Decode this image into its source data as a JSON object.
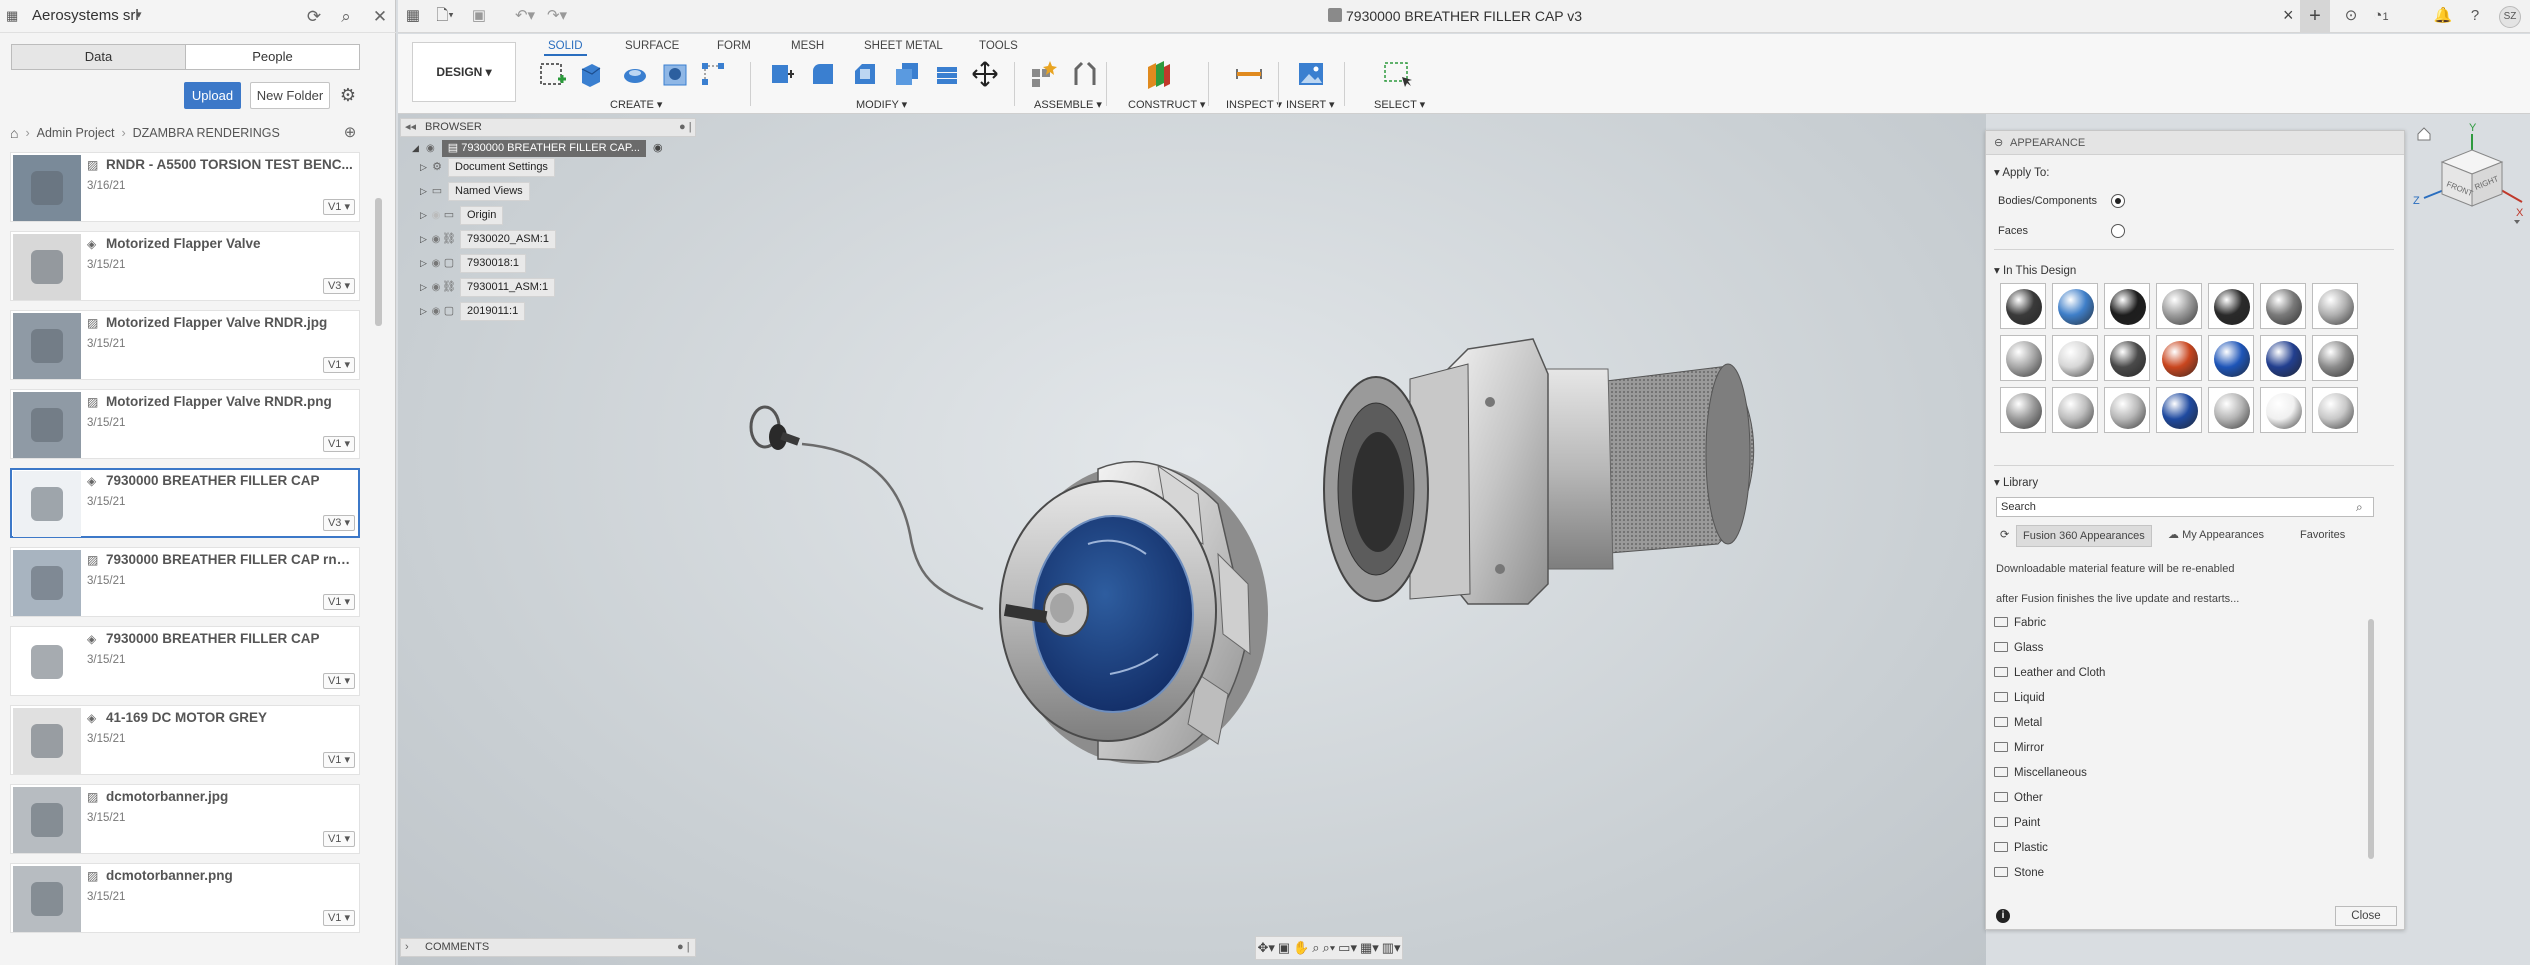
{
  "left_panel": {
    "hub_name": "Aerosystems srl",
    "tabs": [
      {
        "label": "Data",
        "active": true
      },
      {
        "label": "People",
        "active": false
      }
    ],
    "upload_label": "Upload",
    "new_folder_label": "New Folder",
    "breadcrumb": [
      "Admin Project",
      "DZAMBRA RENDERINGS"
    ],
    "items": [
      {
        "name": "RNDR - A5500 TORSION TEST BENC...",
        "date": "3/16/21",
        "version": "V1",
        "type": "image"
      },
      {
        "name": "Motorized Flapper Valve",
        "date": "3/15/21",
        "version": "V3",
        "type": "design"
      },
      {
        "name": "Motorized Flapper Valve RNDR.jpg",
        "date": "3/15/21",
        "version": "V1",
        "type": "image"
      },
      {
        "name": "Motorized Flapper Valve RNDR.png",
        "date": "3/15/21",
        "version": "V1",
        "type": "image"
      },
      {
        "name": "7930000 BREATHER FILLER CAP",
        "date": "3/15/21",
        "version": "V3",
        "type": "design",
        "selected": true
      },
      {
        "name": "7930000 BREATHER FILLER CAP rndr...",
        "date": "3/15/21",
        "version": "V1",
        "type": "image"
      },
      {
        "name": "7930000 BREATHER FILLER CAP",
        "date": "3/15/21",
        "version": "V1",
        "type": "design"
      },
      {
        "name": "41-169 DC MOTOR GREY",
        "date": "3/15/21",
        "version": "V1",
        "type": "design"
      },
      {
        "name": "dcmotorbanner.jpg",
        "date": "3/15/21",
        "version": "V1",
        "type": "image"
      },
      {
        "name": "dcmotorbanner.png",
        "date": "3/15/21",
        "version": "V1",
        "type": "image"
      }
    ]
  },
  "topbar": {
    "document_title": "7930000 BREATHER FILLER CAP v3",
    "job_count": "1",
    "user_initials": "SZ"
  },
  "toolbar": {
    "workspace": "DESIGN",
    "tabs": [
      "SOLID",
      "SURFACE",
      "FORM",
      "MESH",
      "SHEET METAL",
      "TOOLS"
    ],
    "active_tab": "SOLID",
    "groups": [
      "CREATE",
      "MODIFY",
      "ASSEMBLE",
      "CONSTRUCT",
      "INSPECT",
      "INSERT",
      "SELECT"
    ]
  },
  "browser": {
    "title": "BROWSER",
    "root": "7930000 BREATHER FILLER CAP...",
    "nodes": [
      "Document Settings",
      "Named Views",
      "Origin",
      "7930020_ASM:1",
      "7930018:1",
      "7930011_ASM:1",
      "2019011:1"
    ]
  },
  "comments_label": "COMMENTS",
  "appearance": {
    "title": "APPEARANCE",
    "apply_to_label": "Apply To:",
    "opt_bodies": "Bodies/Components",
    "opt_faces": "Faces",
    "selected_option": "Bodies/Components",
    "in_design_label": "In This Design",
    "library_label": "Library",
    "search_placeholder": "Search",
    "lib_tabs": [
      "Fusion 360 Appearances",
      "My Appearances",
      "Favorites"
    ],
    "message_1": "Downloadable material feature will be re-enabled",
    "message_2": "after Fusion finishes the live update and restarts...",
    "folders": [
      "Fabric",
      "Glass",
      "Leather and Cloth",
      "Liquid",
      "Metal",
      "Mirror",
      "Miscellaneous",
      "Other",
      "Paint",
      "Plastic",
      "Stone"
    ],
    "close_label": "Close",
    "swatch_colors": [
      "#3a3a3a",
      "#3f7fc9",
      "#1d1d1d",
      "#9c9c9c",
      "#2a2a2a",
      "#7a7a7a",
      "#b0b0b0",
      "#a8a8a8",
      "#d7d7d7",
      "#4a4a4a",
      "#c9461f",
      "#1e55b8",
      "#223f8f",
      "#8c8c8c",
      "#9a9a9a",
      "#bdbdbd",
      "#b8b8b8",
      "#1f4aa0",
      "#b5b5b5",
      "#f0f0f0",
      "#c8c8c8"
    ]
  },
  "viewcube": {
    "top": "TOP",
    "front": "FRONT",
    "right": "RIGHT",
    "axis_x": "X",
    "axis_y": "Y",
    "axis_z": "Z"
  }
}
